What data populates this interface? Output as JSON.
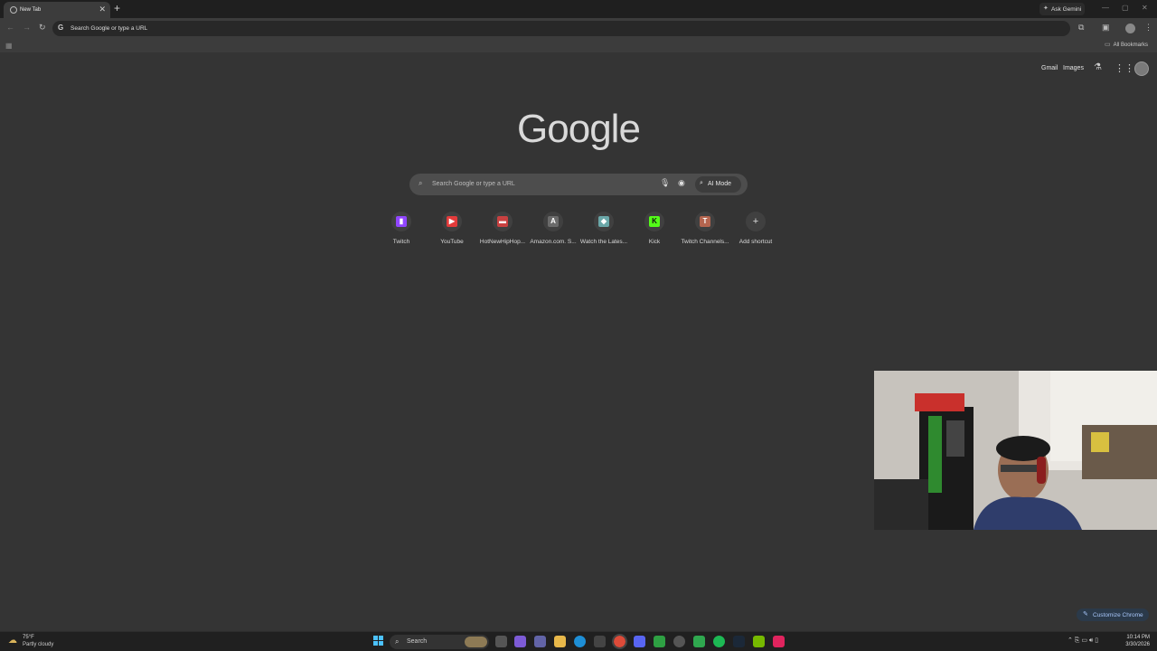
{
  "browser": {
    "tab_title": "New Tab",
    "tab_close": "✕",
    "new_tab": "+",
    "ask_gemini": "Ask Gemini",
    "omnibox_placeholder": "Search Google or type a URL",
    "all_bookmarks": "All Bookmarks"
  },
  "ntp": {
    "gmail": "Gmail",
    "images": "Images",
    "logo": "Google",
    "search_placeholder": "Search Google or type a URL",
    "ai_mode": "AI Mode",
    "customize": "Customize Chrome",
    "shortcuts": [
      {
        "label": "Twitch",
        "color": "#9146ff",
        "glyph": "▮"
      },
      {
        "label": "YouTube",
        "color": "#e33b3b",
        "glyph": "▶"
      },
      {
        "label": "HotNewHipHop...",
        "color": "#c94141",
        "glyph": "▬"
      },
      {
        "label": "Amazon.com. S...",
        "color": "#6b6b6b",
        "glyph": "A"
      },
      {
        "label": "Watch the Lates...",
        "color": "#6aa7a8",
        "glyph": "◆"
      },
      {
        "label": "Kick",
        "color": "#53fc18",
        "glyph": "K"
      },
      {
        "label": "Twitch Channels...",
        "color": "#b5654f",
        "glyph": "T"
      },
      {
        "label": "Add shortcut",
        "color": "#404040",
        "glyph": "+"
      }
    ]
  },
  "taskbar": {
    "temp": "75°F",
    "weather": "Partly cloudy",
    "search": "Search",
    "time": "10:14 PM",
    "date": "3/30/2026"
  }
}
